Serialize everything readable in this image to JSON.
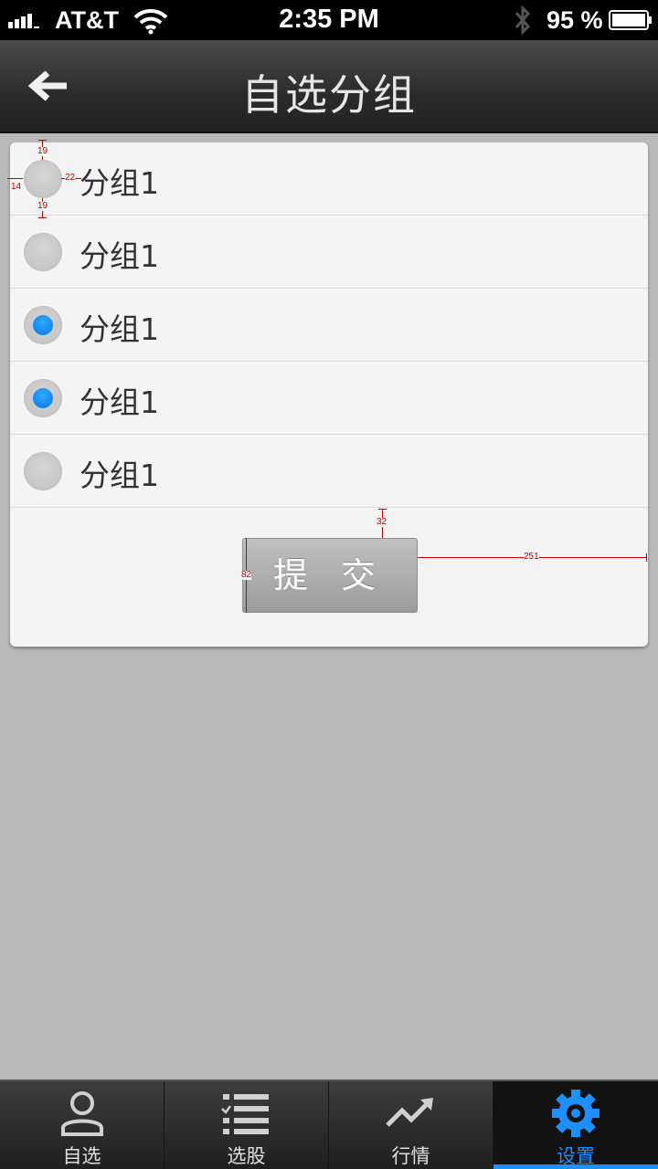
{
  "status_bar": {
    "carrier": "AT&T",
    "time": "2:35 PM",
    "battery_percent": "95 %",
    "signal_bars": 4,
    "battery_level": 0.95
  },
  "nav": {
    "title": "自选分组",
    "back_icon": "arrow-left-icon"
  },
  "groups": [
    {
      "label": "分组1",
      "checked": false
    },
    {
      "label": "分组1",
      "checked": false
    },
    {
      "label": "分组1",
      "checked": true
    },
    {
      "label": "分组1",
      "checked": true
    },
    {
      "label": "分组1",
      "checked": false
    }
  ],
  "submit_label": "提 交",
  "annotations": {
    "radio_top": "19",
    "radio_bottom": "19",
    "radio_left": "14",
    "radio_right": "22",
    "button_gap": "32",
    "button_height": "82",
    "button_right": "251"
  },
  "tabs": [
    {
      "label": "自选",
      "icon": "user-icon",
      "active": false
    },
    {
      "label": "选股",
      "icon": "list-check-icon",
      "active": false
    },
    {
      "label": "行情",
      "icon": "trend-up-icon",
      "active": false
    },
    {
      "label": "设置",
      "icon": "gear-icon",
      "active": true
    }
  ],
  "colors": {
    "accent": "#1e8fff",
    "radio_checked": "#0a84ff",
    "annotation": "#c00000"
  }
}
